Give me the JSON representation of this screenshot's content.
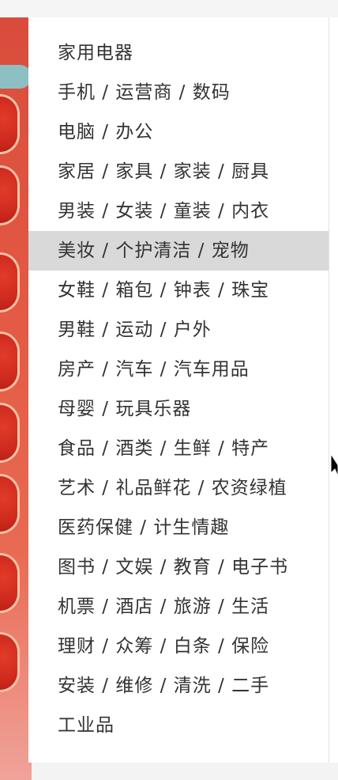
{
  "menu": {
    "items": [
      "家用电器",
      "手机 / 运营商 / 数码",
      "电脑 / 办公",
      "家居 / 家具 / 家装 / 厨具",
      "男装 / 女装 / 童装 / 内衣",
      "美妆 / 个护清洁 / 宠物",
      "女鞋 / 箱包 / 钟表 / 珠宝",
      "男鞋 / 运动 / 户外",
      "房产 / 汽车 / 汽车用品",
      "母婴 / 玩具乐器",
      "食品 / 酒类 / 生鲜 / 特产",
      "艺术 / 礼品鲜花 / 农资绿植",
      "医药保健 / 计生情趣",
      "图书 / 文娱 / 教育 / 电子书",
      "机票 / 酒店 / 旅游 / 生活",
      "理财 / 众筹 / 白条 / 保险",
      "安装 / 维修 / 清洗 / 二手",
      "工业品"
    ],
    "active_index": 5,
    "colors": {
      "text": "#333333",
      "active_background": "#d9d9d9",
      "panel_background": "#ffffff"
    }
  },
  "cursor": {
    "icon": "mouse-pointer-icon"
  }
}
